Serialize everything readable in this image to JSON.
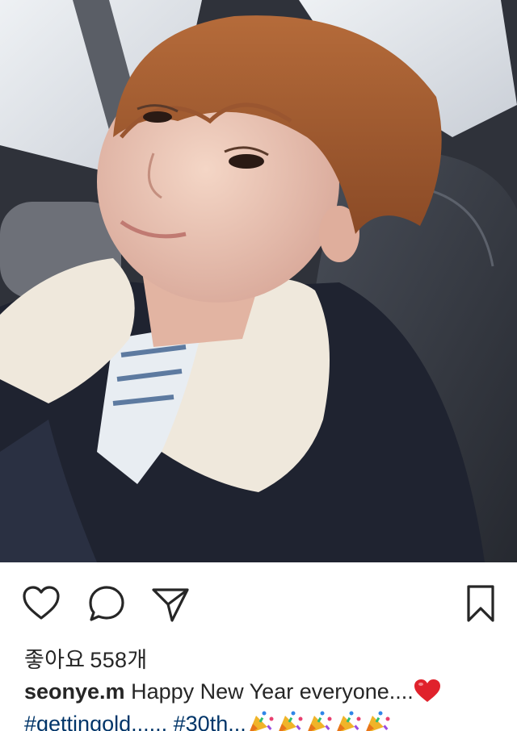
{
  "post": {
    "photo_alt": "selfie"
  },
  "actions": {
    "like_icon": "heart-outline-icon",
    "comment_icon": "speech-bubble-icon",
    "share_icon": "paper-plane-icon",
    "save_icon": "bookmark-icon"
  },
  "likes": {
    "label": "좋아요",
    "count": "558개"
  },
  "caption": {
    "username": "seonye.m",
    "text": "Happy New Year everyone....",
    "heart_emoji": "red-heart-emoji",
    "hashtag_1": "#gettingold......",
    "hashtag_2": "#30th...",
    "party_emoji": "party-popper-emoji",
    "party_emoji_count": 5
  },
  "colors": {
    "text": "#262626",
    "hashtag": "#003569",
    "heart": "#e0222c"
  }
}
